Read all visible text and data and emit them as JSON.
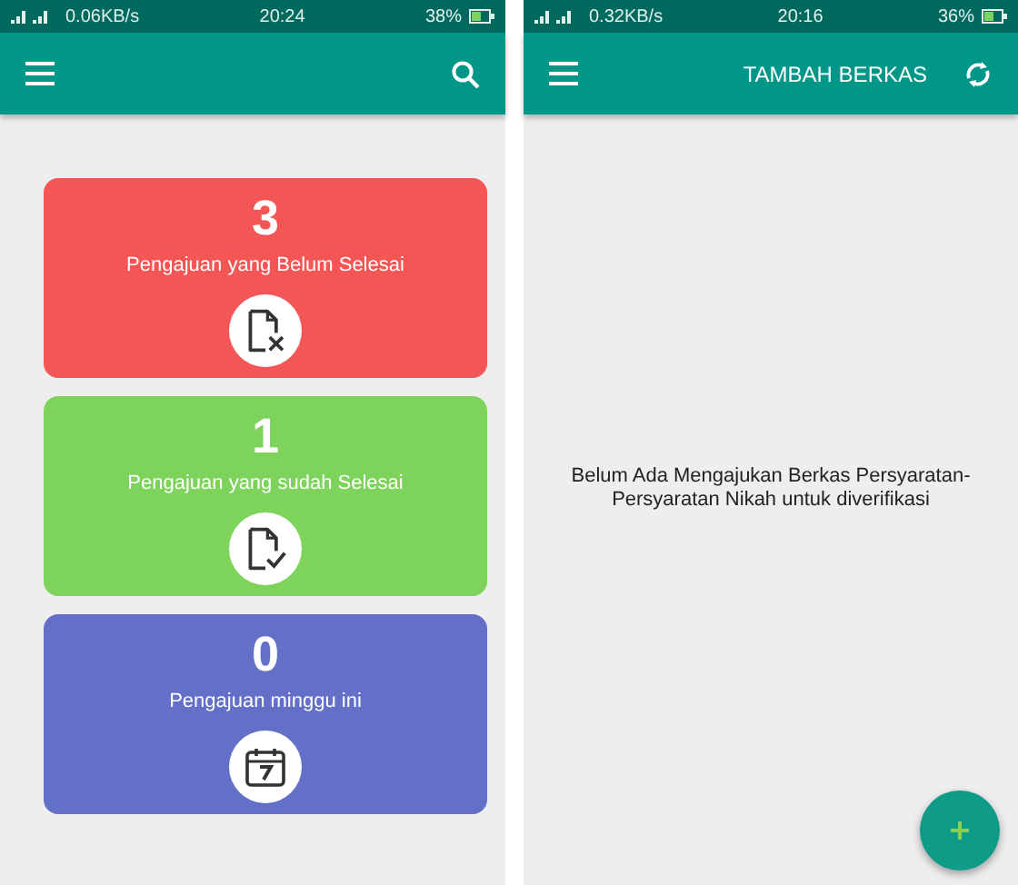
{
  "screens": [
    {
      "status_bar": {
        "speed": "0.06KB/s",
        "time": "20:24",
        "battery": "38%"
      },
      "app_bar": {
        "kind": "search"
      },
      "cards": [
        {
          "kind": "pending",
          "count": "3",
          "label": "Pengajuan yang Belum Selesai",
          "color": "#f45656"
        },
        {
          "kind": "done",
          "count": "1",
          "label": "Pengajuan yang sudah Selesai",
          "color": "#7ed35d"
        },
        {
          "kind": "week",
          "count": "0",
          "label": "Pengajuan minggu ini",
          "color": "#6470c8"
        }
      ]
    },
    {
      "status_bar": {
        "speed": "0.32KB/s",
        "time": "20:16",
        "battery": "36%"
      },
      "app_bar": {
        "title": "TAMBAH BERKAS",
        "kind": "refresh"
      },
      "message": "Belum Ada Mengajukan Berkas Persyaratan-Persyaratan Nikah untuk diverifikasi",
      "fab": {
        "kind": "add"
      }
    }
  ]
}
